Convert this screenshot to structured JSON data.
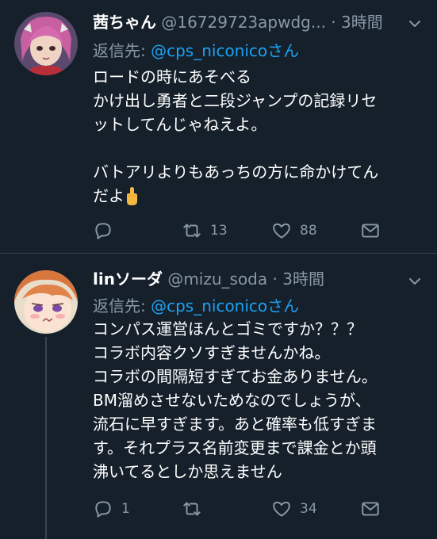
{
  "tweets": [
    {
      "name": "茜ちゃん",
      "handle": "@16729723apwdg...",
      "dot": "·",
      "time": "3時間",
      "reply_label": "返信先:",
      "reply_target": "@cps_niconicoさん",
      "lines": [
        "ロードの時にあそべる",
        "かけ出し勇者と二段ジャンプの記録リセ",
        "ットしてんじゃねえよ。",
        "",
        "バトアリよりもあっちの方に命かけてん",
        "だよ"
      ],
      "emoji": "pointing-up-hand",
      "actions": {
        "reply_count": "",
        "retweet_count": "13",
        "like_count": "88"
      }
    },
    {
      "name": "linソーダ",
      "handle": "@mizu_soda",
      "dot": "·",
      "time": "3時間",
      "reply_label": "返信先:",
      "reply_target": "@cps_niconicoさん",
      "lines": [
        "コンパス運営ほんとゴミですか？？？",
        "コラボ内容クソすぎませんかね。",
        "コラボの間隔短すぎてお金ありません。",
        "BM溜めさせないためなのでしょうが、",
        "流石に早すぎます。あと確率も低すぎま",
        "す。それプラス名前変更まで課金とか頭",
        "沸いてるとしか思えません"
      ],
      "actions": {
        "reply_count": "1",
        "retweet_count": "",
        "like_count": "34"
      }
    }
  ],
  "icons": [
    "chevron-down-icon",
    "reply-icon",
    "retweet-icon",
    "like-icon",
    "share-icon"
  ],
  "colors": {
    "background": "#15202b",
    "text": "#ffffff",
    "muted": "#8899a6",
    "link": "#1da1f2",
    "divider": "#38444d"
  }
}
